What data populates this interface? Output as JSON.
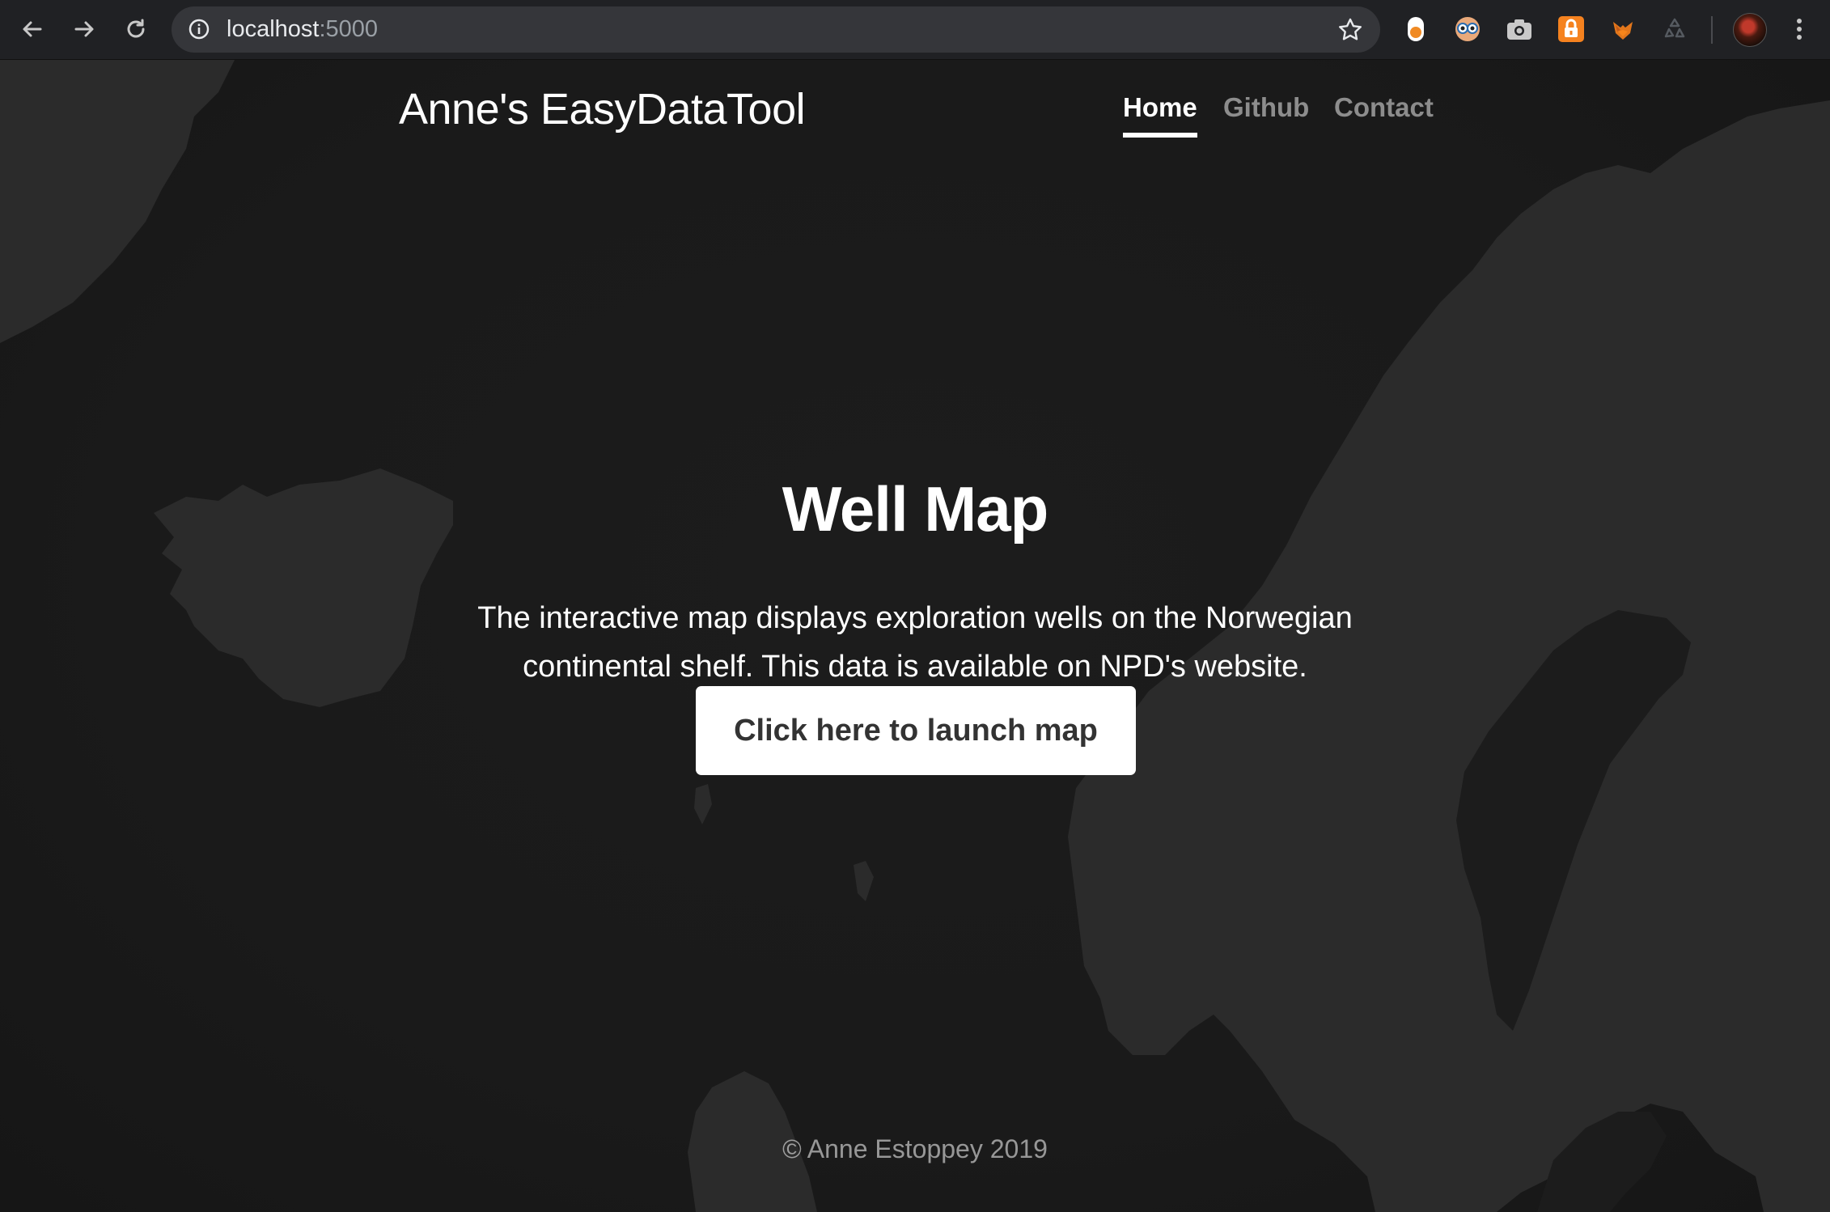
{
  "browser": {
    "url_host": "localhost",
    "url_port": ":5000"
  },
  "site": {
    "brand": "Anne's EasyDataTool",
    "nav": [
      {
        "label": "Home",
        "active": true
      },
      {
        "label": "Github",
        "active": false
      },
      {
        "label": "Contact",
        "active": false
      }
    ]
  },
  "hero": {
    "title": "Well Map",
    "lead": "The interactive map displays exploration wells on the Norwegian continental shelf. This data is available on NPD's website.",
    "button_label": "Click here to launch map"
  },
  "footer": {
    "text": "© Anne Estoppey 2019"
  },
  "colors": {
    "browser_bar": "#202124",
    "omnibox": "#35363a",
    "page_background": "#1a1a1a",
    "land": "#2b2b2b",
    "text_primary": "#ffffff",
    "button_text": "#333333"
  },
  "icons": {
    "back": "back-arrow-icon",
    "forward": "forward-arrow-icon",
    "reload": "reload-icon",
    "info": "info-icon",
    "bookmark": "star-icon",
    "menu": "vertical-dots-menu-icon"
  }
}
